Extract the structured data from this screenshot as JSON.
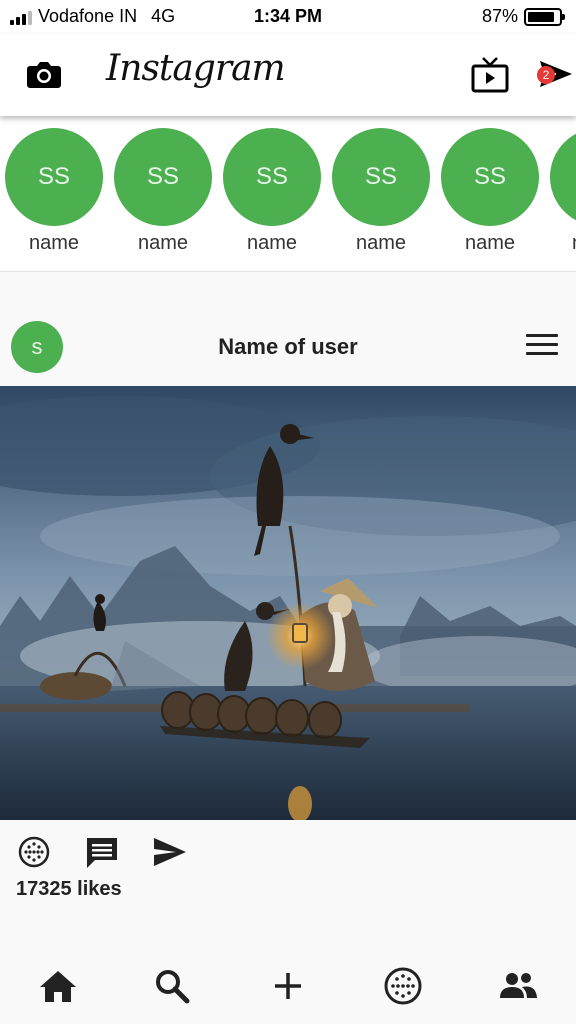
{
  "status_bar": {
    "carrier": "Vodafone IN",
    "network": "4G",
    "time": "1:34 PM",
    "battery": "87%",
    "battery_level": 0.87
  },
  "header": {
    "logo": "Instagram",
    "camera_icon": "camera-icon",
    "tv_icon": "igtv-icon",
    "send_icon": "direct-send-icon",
    "notification_count": "2"
  },
  "stories": [
    {
      "initials": "SS",
      "label": "name"
    },
    {
      "initials": "SS",
      "label": "name"
    },
    {
      "initials": "SS",
      "label": "name"
    },
    {
      "initials": "SS",
      "label": "name"
    },
    {
      "initials": "SS",
      "label": "name"
    },
    {
      "initials": "",
      "label": "n"
    }
  ],
  "post": {
    "avatar_initial": "s",
    "username": "Name of user",
    "menu_icon": "hamburger-menu-icon",
    "likes": "17325 likes"
  },
  "post_actions": [
    "dotted-circle-like-icon",
    "comment-icon",
    "share-send-icon"
  ],
  "bottom_nav": [
    "home-icon",
    "search-icon",
    "add-icon",
    "dotted-circle-activity-icon",
    "people-icon"
  ],
  "colors": {
    "story_green": "#4caf50",
    "badge_red": "#e53935"
  }
}
